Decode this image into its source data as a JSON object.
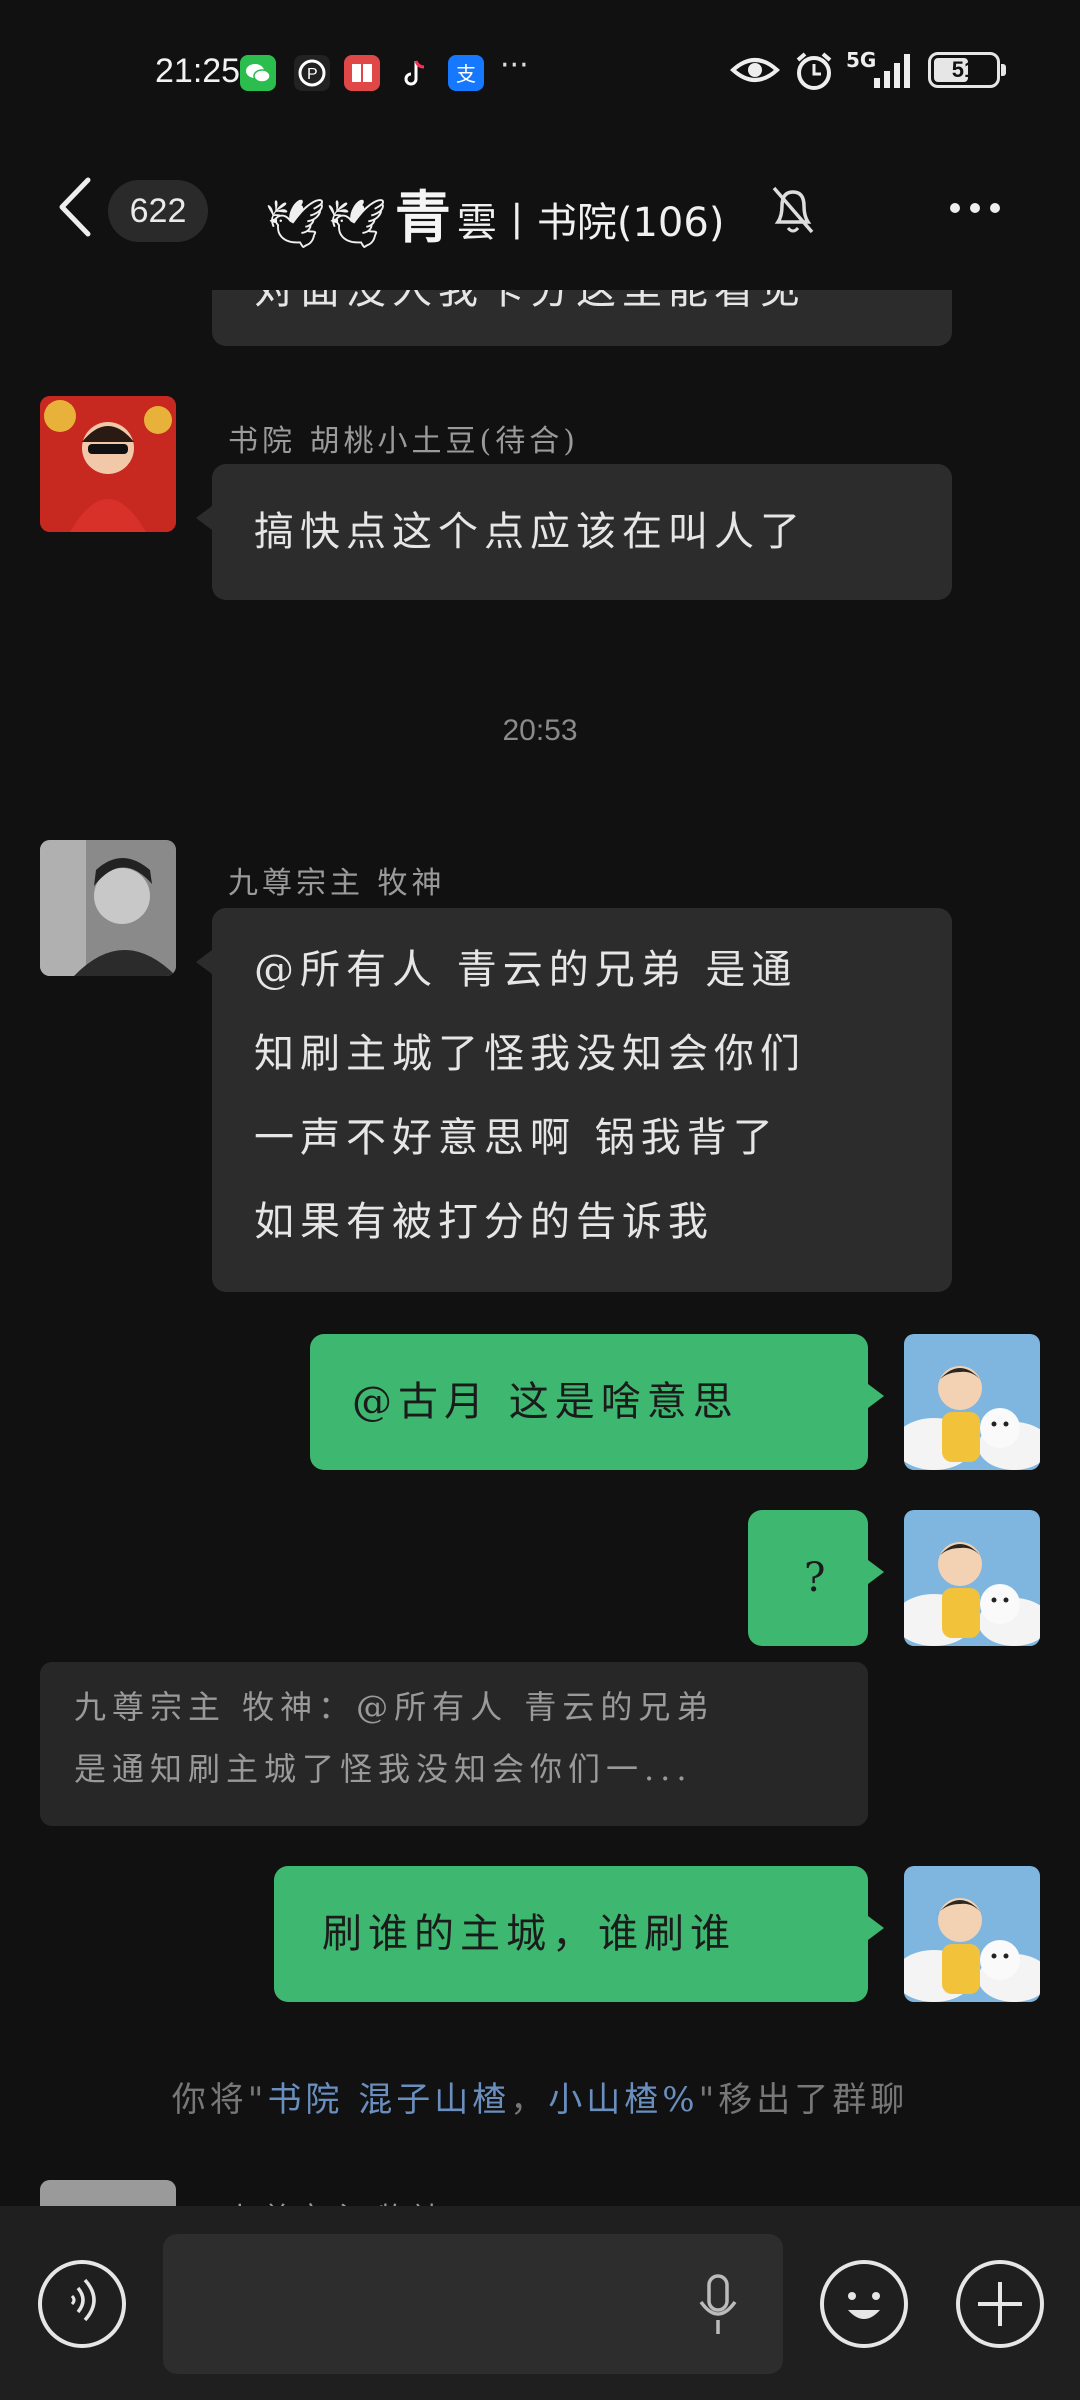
{
  "status_bar": {
    "time": "21:25",
    "network": "5G",
    "battery": "51",
    "app_icons": [
      "wechat-icon",
      "p-app-icon",
      "book-app-icon",
      "tiktok-icon",
      "alipay-icon"
    ],
    "more": "···"
  },
  "header": {
    "unread_count": "622",
    "title_prefix": "🕊🕊",
    "title_big": "青",
    "title_rest": "雲丨书院(106)",
    "muted": true
  },
  "messages": {
    "prev_fragment": "对面没人我卡分这里能看见",
    "m1": {
      "sender": "书院  胡桃小土豆(待合)",
      "text": "搞快点这个点应该在叫人了"
    },
    "timestamp": "20:53",
    "m2": {
      "sender": "九尊宗主 牧神",
      "lines": [
        "@所有人  青云的兄弟 是通",
        "知刷主城了怪我没知会你们",
        "一声不好意思啊 锅我背了",
        "如果有被打分的告诉我"
      ]
    },
    "m3": {
      "text": "@古月  这是啥意思"
    },
    "m4": {
      "text": "?"
    },
    "quote": {
      "line1": "九尊宗主 牧神：@所有人 青云的兄弟",
      "line2": "是通知刷主城了怪我没知会你们一..."
    },
    "m5": {
      "text": "刷谁的主城，谁刷谁"
    },
    "system": {
      "before": "你将\"",
      "name1": "书院 混子山楂",
      "sep": "，",
      "name2": "小山楂%",
      "after": "\"移出了群聊"
    },
    "next_sender": "九尊宗主 牧神"
  },
  "input_bar": {
    "voice_icon": "voice-wave-icon",
    "mic_icon": "microphone-icon",
    "emoji_icon": "emoji-icon",
    "plus_icon": "plus-icon"
  },
  "colors": {
    "background": "#111111",
    "bubble_in": "#2c2c2c",
    "bubble_out": "#3eb870",
    "system_link": "#6a8fbf"
  }
}
